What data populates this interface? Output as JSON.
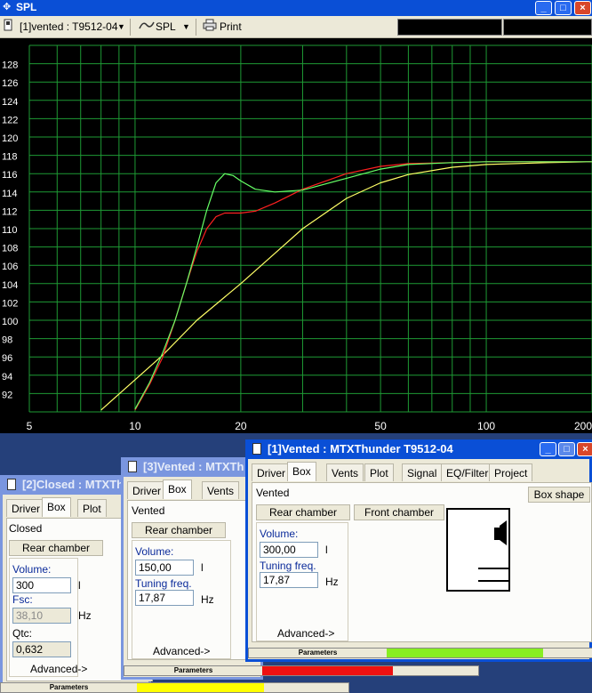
{
  "app": {
    "title": "SPL",
    "colors": {
      "titlebar": "#0a4fd6",
      "plot_bg": "#000000",
      "grid": "#1e9a34"
    }
  },
  "toolbar": {
    "project_dropdown": "[1]vented : T9512-04",
    "spl_dropdown": "SPL",
    "print_label": "Print"
  },
  "chart_data": {
    "type": "line",
    "xscale": "log",
    "xlim": [
      5,
      200
    ],
    "ylim": [
      90,
      130
    ],
    "x_ticks": [
      "5",
      "10",
      "20",
      "50",
      "100",
      "200"
    ],
    "y_ticks": [
      "92",
      "94",
      "96",
      "98",
      "100",
      "102",
      "104",
      "106",
      "108",
      "110",
      "112",
      "114",
      "116",
      "118",
      "120",
      "122",
      "124",
      "126",
      "128"
    ],
    "grid": true,
    "series": [
      {
        "color": "#ffff66",
        "points": [
          [
            8,
            90.2
          ],
          [
            10,
            93.5
          ],
          [
            12,
            96.2
          ],
          [
            15,
            100
          ],
          [
            20,
            104
          ],
          [
            25,
            107.3
          ],
          [
            30,
            110
          ],
          [
            40,
            113.3
          ],
          [
            50,
            115
          ],
          [
            60,
            115.9
          ],
          [
            80,
            116.7
          ],
          [
            100,
            117
          ],
          [
            150,
            117.2
          ],
          [
            200,
            117.3
          ]
        ]
      },
      {
        "color": "#ff2020",
        "points": [
          [
            10,
            90.2
          ],
          [
            11,
            93
          ],
          [
            12,
            96
          ],
          [
            13,
            100
          ],
          [
            14,
            104
          ],
          [
            15,
            107.5
          ],
          [
            16,
            110
          ],
          [
            17,
            111.3
          ],
          [
            18,
            111.7
          ],
          [
            20,
            111.7
          ],
          [
            22,
            111.9
          ],
          [
            25,
            112.8
          ],
          [
            30,
            114.3
          ],
          [
            40,
            116
          ],
          [
            50,
            116.8
          ],
          [
            60,
            117.1
          ],
          [
            80,
            117.2
          ],
          [
            100,
            117.3
          ],
          [
            150,
            117.3
          ],
          [
            200,
            117.3
          ]
        ]
      },
      {
        "color": "#66ff66",
        "points": [
          [
            10,
            90.3
          ],
          [
            11,
            93.2
          ],
          [
            12,
            96.5
          ],
          [
            13,
            100
          ],
          [
            14,
            104
          ],
          [
            15,
            108
          ],
          [
            16,
            112
          ],
          [
            17,
            115
          ],
          [
            18,
            116
          ],
          [
            19,
            115.8
          ],
          [
            20,
            115.2
          ],
          [
            22,
            114.3
          ],
          [
            25,
            114
          ],
          [
            30,
            114.2
          ],
          [
            40,
            115.5
          ],
          [
            50,
            116.5
          ],
          [
            60,
            117
          ],
          [
            80,
            117.2
          ],
          [
            100,
            117.3
          ],
          [
            150,
            117.3
          ],
          [
            200,
            117.3
          ]
        ]
      }
    ]
  },
  "win1": {
    "title": "[1]Vented : MTXThunder T9512-04",
    "tabs": [
      "Driver",
      "Box",
      "Vents",
      "Plot",
      "Signal",
      "EQ/Filter",
      "Project"
    ],
    "box_type": "Vented",
    "box_shape_button": "Box shape",
    "rear_chamber": "Rear chamber",
    "front_chamber": "Front chamber",
    "volume_label": "Volume:",
    "volume_value": "300,00",
    "volume_unit": "l",
    "tuning_label": "Tuning freq.",
    "tuning_value": "17,87",
    "tuning_unit": "Hz",
    "advanced": "Advanced->",
    "status_label": "Parameters",
    "status_color": "#88ee22",
    "status_fill": 0.75
  },
  "win3": {
    "title": "[3]Vented : MTXTh",
    "tabs": [
      "Driver",
      "Box",
      "Vents"
    ],
    "box_type": "Vented",
    "rear_chamber": "Rear chamber",
    "volume_label": "Volume:",
    "volume_value": "150,00",
    "volume_unit": "l",
    "tuning_label": "Tuning freq.",
    "tuning_value": "17,87",
    "tuning_unit": "Hz",
    "advanced": "Advanced->",
    "status_label": "Parameters",
    "status_color": "#ee1111",
    "status_fill": 0.6
  },
  "win2": {
    "title": "[2]Closed : MTXTh",
    "tabs": [
      "Driver",
      "Box",
      "Plot"
    ],
    "box_type": "Closed",
    "rear_chamber": "Rear chamber",
    "volume_label": "Volume:",
    "volume_value": "300",
    "volume_unit": "l",
    "fsc_label": "Fsc:",
    "fsc_value": "38,10",
    "fsc_unit": "Hz",
    "qtc_label": "Qtc:",
    "qtc_value": "0,632",
    "advanced": "Advanced->",
    "status_label": "Parameters",
    "status_color": "#ffff00",
    "status_fill": 0.6
  }
}
